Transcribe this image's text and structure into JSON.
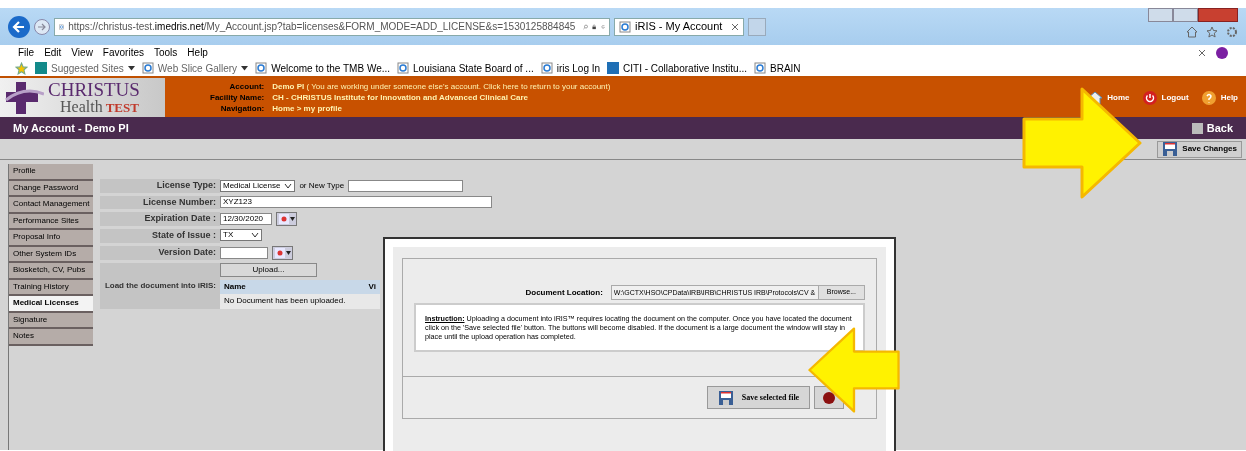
{
  "browser": {
    "url_host": "https://christus-test.",
    "url_domain": "imedris.net",
    "url_path": "/My_Account.jsp?tab=licenses&FORM_MODE=ADD_LICENSE&s=1530125884845",
    "tab_title": "iRIS - My Account",
    "menu": [
      "File",
      "Edit",
      "View",
      "Favorites",
      "Tools",
      "Help"
    ],
    "favorites": [
      {
        "label": "Suggested Sites",
        "kind": "bing",
        "dropdown": true
      },
      {
        "label": "Web Slice Gallery",
        "kind": "ie",
        "dropdown": true
      },
      {
        "label": "Welcome to the TMB We...",
        "kind": "ie",
        "dropdown": false
      },
      {
        "label": "Louisiana State Board of ...",
        "kind": "ie",
        "dropdown": false
      },
      {
        "label": "iris Log In",
        "kind": "ie",
        "dropdown": false
      },
      {
        "label": "CITI - Collaborative Institu...",
        "kind": "citi",
        "dropdown": false
      },
      {
        "label": "BRAIN",
        "kind": "ie",
        "dropdown": false
      }
    ]
  },
  "header": {
    "logo_name": "CHRISTUS",
    "logo_sub": "Health",
    "logo_tag": "TEST",
    "info": [
      {
        "label": "Account:",
        "value": "Demo PI",
        "note": "( You are working under someone else's account. Click here to return to your account)"
      },
      {
        "label": "Facility Name:",
        "value": "CH - CHRISTUS Institute for Innovation and Advanced Clinical Care"
      },
      {
        "label": "Navigation:",
        "value": "Home > my profile"
      }
    ],
    "links": [
      {
        "label": "Home",
        "kind": "home"
      },
      {
        "label": "Logout",
        "kind": "logout"
      },
      {
        "label": "Help",
        "kind": "help"
      }
    ]
  },
  "page_title": "My Account - Demo PI",
  "back": "Back",
  "save_changes": "Save Changes",
  "sidebar": [
    {
      "label": "Profile",
      "selected": false
    },
    {
      "label": "Change Password",
      "selected": false
    },
    {
      "label": "Contact Management",
      "selected": false
    },
    {
      "label": "Performance Sites",
      "selected": false
    },
    {
      "label": "Proposal Info",
      "selected": false
    },
    {
      "label": "Other System IDs",
      "selected": false
    },
    {
      "label": "Biosketch, CV, Pubs",
      "selected": false
    },
    {
      "label": "Training History",
      "selected": false
    },
    {
      "label": "Medical Licenses",
      "selected": true
    },
    {
      "label": "Signature",
      "selected": false
    },
    {
      "label": "Notes",
      "selected": false
    }
  ],
  "form": {
    "license_type": {
      "label": "License Type:",
      "value": "Medical License",
      "or": "or New Type"
    },
    "license_number": {
      "label": "License Number:",
      "value": "XYZ123"
    },
    "expiration_date": {
      "label": "Expiration Date :",
      "value": "12/30/2020"
    },
    "state": {
      "label": "State of Issue :",
      "value": "TX"
    },
    "version_date": {
      "label": "Version Date:"
    },
    "upload": "Upload...",
    "document": {
      "label": "Load the document into iRIS:",
      "columns": [
        "Name",
        "Vi"
      ],
      "empty": "No Document has been uploaded."
    }
  },
  "dialog": {
    "location_label": "Document Location:",
    "location_value": "W:\\GCTX\\HSO\\CPData\\IRB\\IRB\\CHRISTUS IRB\\Protocols\\CV &",
    "browse": "Browse...",
    "instruction_title": "Instruction:",
    "instruction": "Uploading a document into iRIS™ requires locating the document on the computer. Once you have located the document click on the 'Save selected file' button. The buttons will become disabled. If the document is a large document the window will stay in place until the upload operation has completed.",
    "save_file": "Save selected file"
  }
}
